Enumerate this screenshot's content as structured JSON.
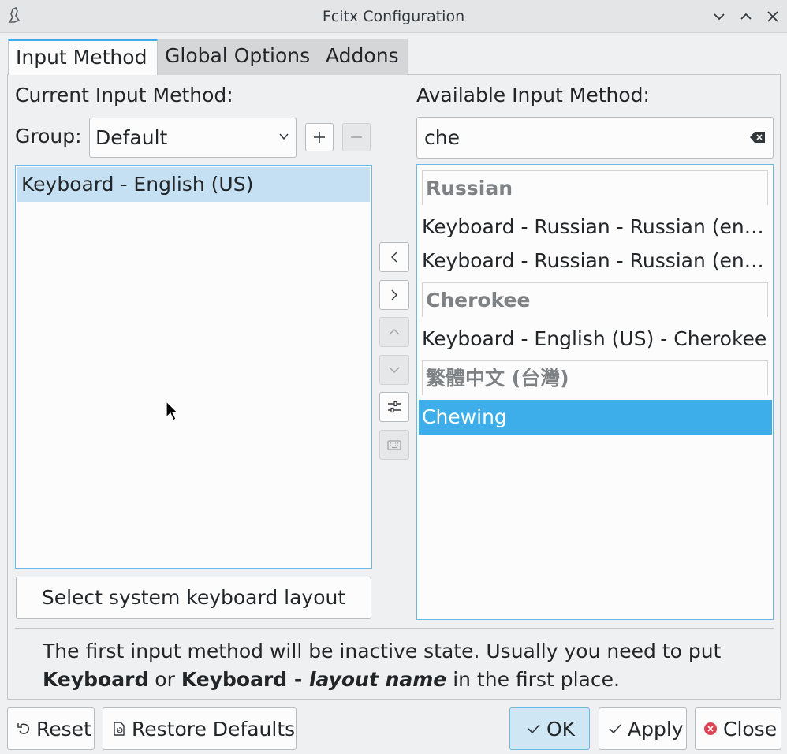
{
  "window": {
    "title": "Fcitx Configuration"
  },
  "tabs": [
    {
      "label": "Input Method",
      "active": true
    },
    {
      "label": "Global Options",
      "active": false
    },
    {
      "label": "Addons",
      "active": false
    }
  ],
  "current": {
    "heading": "Current Input Method:",
    "group_label": "Group:",
    "group_value": "Default",
    "items": [
      "Keyboard - English (US)"
    ],
    "select_layout_button": "Select system keyboard layout"
  },
  "available": {
    "heading": "Available Input Method:",
    "search_value": "che",
    "groups": [
      {
        "header": "Russian",
        "items": [
          "Keyboard - Russian - Russian (engi…",
          "Keyboard - Russian - Russian (engi…"
        ]
      },
      {
        "header": "Cherokee",
        "items": [
          "Keyboard - English (US) - Cherokee"
        ]
      },
      {
        "header": "繁體中文 (台灣)",
        "items": [
          "Chewing"
        ]
      }
    ],
    "selected_item": "Chewing"
  },
  "info": {
    "line1": "The first input method will be inactive state. Usually you need to put",
    "b1": "Keyboard",
    "or": " or ",
    "b2": "Keyboard - ",
    "b2i": "layout name",
    "rest": " in the first place."
  },
  "buttons": {
    "reset": "Reset",
    "restore": "Restore Defaults",
    "ok": "OK",
    "apply": "Apply",
    "close": "Close"
  },
  "colors": {
    "accent": "#3daee9",
    "selection_light": "#c4e0f2",
    "close_red": "#da4453"
  }
}
